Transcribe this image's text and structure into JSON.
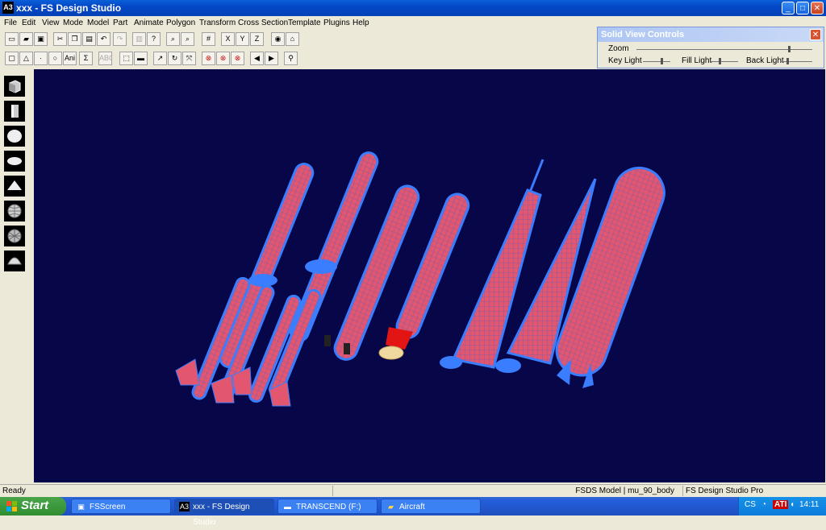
{
  "window": {
    "title": "xxx - FS Design Studio",
    "app_icon": "A3",
    "controls": {
      "minimize": "_",
      "maximize": "□",
      "close": "✕"
    }
  },
  "menu": [
    "File",
    "Edit",
    "View",
    "Mode",
    "Model",
    "Part",
    "Animate",
    "Polygon",
    "Transform",
    "Cross Section",
    "Template",
    "Plugins",
    "Help"
  ],
  "toolbar1": {
    "buttons": [
      {
        "name": "new-icon",
        "glyph": "▭"
      },
      {
        "name": "open-icon",
        "glyph": "▰"
      },
      {
        "name": "save-icon",
        "glyph": "▣"
      },
      {
        "name": "cut-icon",
        "glyph": "✂"
      },
      {
        "name": "copy-icon",
        "glyph": "❐"
      },
      {
        "name": "paste-icon",
        "glyph": "▤"
      },
      {
        "name": "undo-icon",
        "glyph": "↶"
      },
      {
        "name": "redo-icon",
        "glyph": "↷"
      },
      {
        "name": "print-icon",
        "glyph": "▥"
      },
      {
        "name": "help-icon",
        "glyph": "?"
      },
      {
        "name": "zoom-in-icon",
        "glyph": "⌕"
      },
      {
        "name": "zoom-out-icon",
        "glyph": "⌕"
      },
      {
        "name": "grid-icon",
        "glyph": "#"
      },
      {
        "name": "axis-x-icon",
        "glyph": "X"
      },
      {
        "name": "axis-y-icon",
        "glyph": "Y"
      },
      {
        "name": "axis-z-icon",
        "glyph": "Z"
      },
      {
        "name": "view-icon",
        "glyph": "◉"
      },
      {
        "name": "home-icon",
        "glyph": "⌂"
      }
    ]
  },
  "toolbar2": {
    "buttons": [
      {
        "name": "select-icon",
        "glyph": "▢"
      },
      {
        "name": "triangle-icon",
        "glyph": "△"
      },
      {
        "name": "point-icon",
        "glyph": "·"
      },
      {
        "name": "circle-icon",
        "glyph": "○"
      },
      {
        "name": "animate-icon",
        "glyph": "Ani"
      },
      {
        "name": "sum-icon",
        "glyph": "Σ"
      },
      {
        "name": "text-icon",
        "glyph": "ABC"
      },
      {
        "name": "marquee-icon",
        "glyph": "⬚"
      },
      {
        "name": "ruler-icon",
        "glyph": "▬"
      },
      {
        "name": "move-icon",
        "glyph": "↗"
      },
      {
        "name": "rotate-icon",
        "glyph": "↻"
      },
      {
        "name": "scale-icon",
        "glyph": "⤧"
      },
      {
        "name": "stop-icon",
        "glyph": "⊗"
      },
      {
        "name": "stop-alt-icon",
        "glyph": "⊗"
      },
      {
        "name": "stop-all-icon",
        "glyph": "⊗"
      },
      {
        "name": "prev-icon",
        "glyph": "◀"
      },
      {
        "name": "next-icon",
        "glyph": "▶"
      },
      {
        "name": "binoculars-icon",
        "glyph": "⚲"
      }
    ]
  },
  "solid_view": {
    "title": "Solid View Controls",
    "close": "✕",
    "zoom_label": "Zoom",
    "key_light_label": "Key Light",
    "fill_light_label": "Fill Light",
    "back_light_label": "Back Light"
  },
  "left_tools": [
    "cube-icon",
    "cylinder-icon",
    "sphere-icon",
    "disc-icon",
    "cone-icon",
    "globe-icon",
    "sphere-detailed-icon",
    "dome-icon"
  ],
  "status": {
    "left": "Ready",
    "model": "FSDS Model | mu_90_body",
    "app": "FS Design Studio Pro"
  },
  "taskbar": {
    "start": "Start",
    "tasks": [
      {
        "label": "FSScreen",
        "icon": "▣"
      },
      {
        "label": "xxx - FS Design Studio",
        "icon": "A3",
        "active": true
      },
      {
        "label": "TRANSCEND (F:)",
        "icon": "▬"
      },
      {
        "label": "Aircraft",
        "icon": "▰"
      }
    ],
    "tray_lang": "CS",
    "tray_ati": "ATI",
    "clock": "14:11"
  },
  "colors": {
    "viewport_bg": "#060648",
    "rocket_body": "#e0506a",
    "rocket_edge": "#3a7cff"
  }
}
